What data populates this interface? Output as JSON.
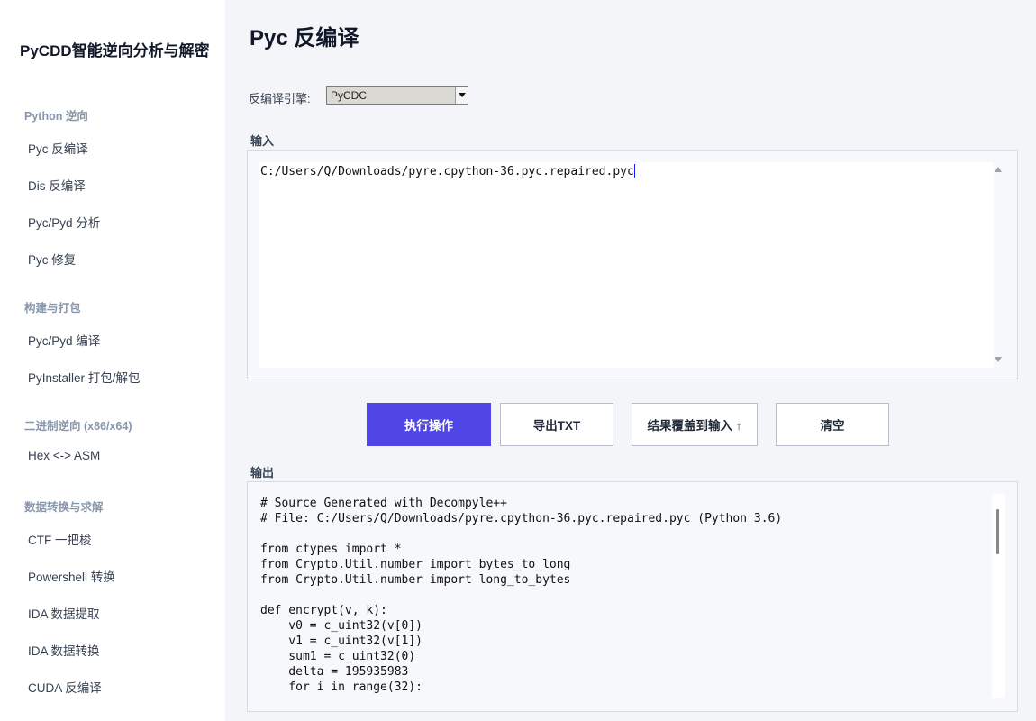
{
  "app": {
    "title": "PyCDD智能逆向分析与解密"
  },
  "sidebar": {
    "sections": [
      {
        "heading": "Python 逆向",
        "items": [
          "Pyc 反编译",
          "Dis 反编译",
          "Pyc/Pyd 分析",
          "Pyc 修复"
        ]
      },
      {
        "heading": "构建与打包",
        "items": [
          "Pyc/Pyd 编译",
          "PyInstaller 打包/解包"
        ]
      },
      {
        "heading": "二进制逆向 (x86/x64)",
        "items": [
          "Hex <-> ASM"
        ]
      },
      {
        "heading": "数据转换与求解",
        "items": [
          "CTF 一把梭",
          "Powershell 转换",
          "IDA 数据提取",
          "IDA 数据转换",
          "CUDA 反编译"
        ]
      }
    ]
  },
  "main": {
    "title": "Pyc 反编译",
    "engine": {
      "label": "反编译引擎:",
      "value": "PyCDC"
    },
    "input": {
      "label": "输入",
      "value": "C:/Users/Q/Downloads/pyre.cpython-36.pyc.repaired.pyc"
    },
    "buttons": {
      "execute": "执行操作",
      "export": "导出TXT",
      "overwrite": "结果覆盖到输入 ↑",
      "clear": "清空"
    },
    "output": {
      "label": "输出",
      "text": "# Source Generated with Decompyle++\n# File: C:/Users/Q/Downloads/pyre.cpython-36.pyc.repaired.pyc (Python 3.6)\n\nfrom ctypes import *\nfrom Crypto.Util.number import bytes_to_long\nfrom Crypto.Util.number import long_to_bytes\n\ndef encrypt(v, k):\n    v0 = c_uint32(v[0])\n    v1 = c_uint32(v[1])\n    sum1 = c_uint32(0)\n    delta = 195935983\n    for i in range(32):"
    }
  },
  "colors": {
    "accent": "#4f46e5",
    "sidebar_bg": "#ffffff",
    "page_bg": "#f3f5f9"
  }
}
